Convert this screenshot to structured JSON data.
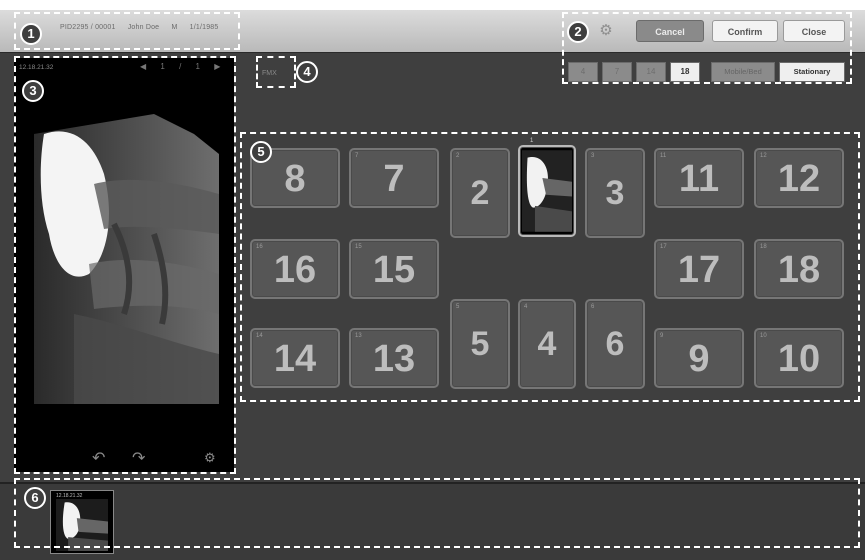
{
  "topbar": {
    "patient_id": "PID2295 / 00001",
    "patient_name": "John Doe",
    "sex": "M",
    "birth": "1/1/1985",
    "settings_icon": "gear-icon",
    "cancel_label": "Cancel",
    "confirm_label": "Confirm",
    "close_label": "Close"
  },
  "count_selector": {
    "options": [
      "4",
      "7",
      "14",
      "18"
    ],
    "selected": "18"
  },
  "mode_selector": {
    "options": [
      "Mobile/Bed",
      "Stationary"
    ],
    "selected": "Stationary"
  },
  "preview_panel": {
    "date": "12.18.21.32",
    "pager": [
      "◀",
      "1",
      "/",
      "1",
      "▶"
    ],
    "icons": [
      "rotate-left-icon",
      "rotate-right-icon",
      "gear-icon"
    ]
  },
  "series_label": "FMX",
  "tiles": [
    {
      "label": "8",
      "tag": "8"
    },
    {
      "label": "7",
      "tag": "7"
    },
    {
      "label": "2",
      "tag": "2"
    },
    {
      "label": "",
      "tag": "1"
    },
    {
      "label": "3",
      "tag": "3"
    },
    {
      "label": "11",
      "tag": "11"
    },
    {
      "label": "12",
      "tag": "12"
    },
    {
      "label": "16",
      "tag": "16"
    },
    {
      "label": "15",
      "tag": "15"
    },
    {
      "label": "17",
      "tag": "17"
    },
    {
      "label": "18",
      "tag": "18"
    },
    {
      "label": "14",
      "tag": "14"
    },
    {
      "label": "13",
      "tag": "13"
    },
    {
      "label": "5",
      "tag": "5"
    },
    {
      "label": "4",
      "tag": "4"
    },
    {
      "label": "6",
      "tag": "6"
    },
    {
      "label": "9",
      "tag": "9"
    },
    {
      "label": "10",
      "tag": "10"
    }
  ],
  "thumbnail": {
    "tag": "12.18.21.32"
  },
  "annotations": [
    "1",
    "2",
    "3",
    "4",
    "5",
    "6"
  ],
  "colors": {
    "background": "#3f3f3f",
    "topbar": "#c8c8c8",
    "tile": "#565656",
    "tile_text": "#bdbdbd",
    "annotation": "#ffffff"
  }
}
